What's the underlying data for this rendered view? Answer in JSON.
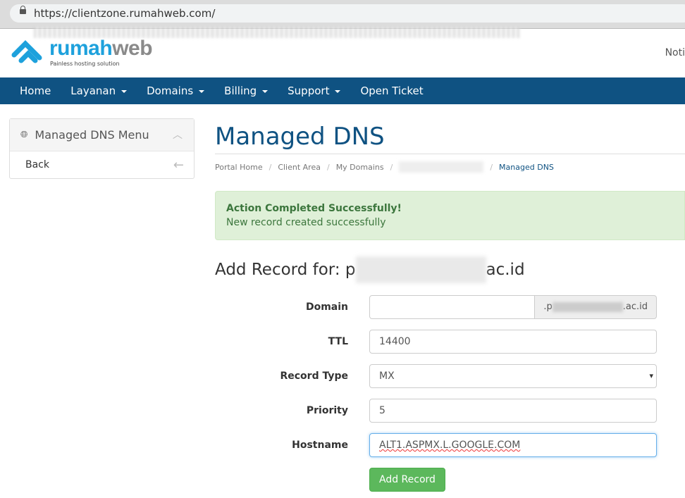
{
  "browser": {
    "url": "https://clientzone.rumahweb.com/"
  },
  "brand": {
    "name_a": "rumah",
    "name_b": "web",
    "tagline": "Painless hosting solution",
    "color": "#1ea1dc"
  },
  "header": {
    "notifications": "Noti"
  },
  "nav": {
    "items": [
      {
        "label": "Home",
        "dropdown": false
      },
      {
        "label": "Layanan",
        "dropdown": true
      },
      {
        "label": "Domains",
        "dropdown": true
      },
      {
        "label": "Billing",
        "dropdown": true
      },
      {
        "label": "Support",
        "dropdown": true
      },
      {
        "label": "Open Ticket",
        "dropdown": false
      }
    ],
    "bg": "#0f5282"
  },
  "sidebar": {
    "title": "Managed DNS Menu",
    "back": "Back"
  },
  "page": {
    "title": "Managed DNS"
  },
  "breadcrumb": [
    "Portal Home",
    "Client Area",
    "My Domains",
    "Managed DNS"
  ],
  "alert": {
    "title": "Action Completed Successfully!",
    "message": "New record created successfully"
  },
  "add_record": {
    "heading_prefix": "Add Record for: p",
    "heading_suffix": "ac.id"
  },
  "form": {
    "domain": {
      "label": "Domain",
      "value": "",
      "suffix_start": ".p",
      "suffix_end": ".ac.id"
    },
    "ttl": {
      "label": "TTL",
      "value": "14400"
    },
    "record_type": {
      "label": "Record Type",
      "value": "MX"
    },
    "priority": {
      "label": "Priority",
      "value": "5"
    },
    "hostname": {
      "label": "Hostname",
      "value": "ALT1.ASPMX.L.GOOGLE.COM"
    },
    "submit": "Add Record"
  }
}
